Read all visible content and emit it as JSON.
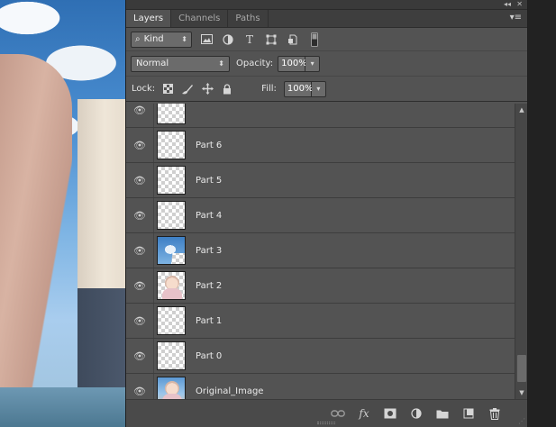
{
  "panel": {
    "collapse_icon": "double-chevron-left-icon",
    "close_icon": "close-x-icon",
    "tabs": [
      {
        "label": "Layers",
        "active": true
      },
      {
        "label": "Channels",
        "active": false
      },
      {
        "label": "Paths",
        "active": false
      }
    ],
    "menu_icon": "panel-menu-icon"
  },
  "filter": {
    "kind_label": "Kind",
    "icons": [
      "pixel-layer-filter-icon",
      "adjustment-filter-icon",
      "type-filter-icon",
      "shape-filter-icon",
      "smart-object-filter-icon",
      "filter-toggle-icon"
    ]
  },
  "blend": {
    "mode": "Normal",
    "opacity_label": "Opacity:",
    "opacity_value": "100%"
  },
  "lock": {
    "label": "Lock:",
    "icons": [
      "lock-transparent-pixels-icon",
      "lock-image-pixels-icon",
      "lock-position-icon",
      "lock-all-icon"
    ],
    "fill_label": "Fill:",
    "fill_value": "100%"
  },
  "layers": [
    {
      "name": "",
      "thumb": "transparent",
      "visible": true
    },
    {
      "name": "Part 6",
      "thumb": "transparent",
      "visible": true
    },
    {
      "name": "Part 5",
      "thumb": "transparent",
      "visible": true
    },
    {
      "name": "Part 4",
      "thumb": "transparent",
      "visible": true
    },
    {
      "name": "Part 3",
      "thumb": "sky",
      "visible": true
    },
    {
      "name": "Part 2",
      "thumb": "girl",
      "visible": true
    },
    {
      "name": "Part 1",
      "thumb": "transparent",
      "visible": true
    },
    {
      "name": "Part 0",
      "thumb": "transparent",
      "visible": true
    },
    {
      "name": "Original_Image",
      "thumb": "photo",
      "visible": true
    }
  ],
  "bottom_toolbar": {
    "icons": [
      "link-layers-icon",
      "fx-layer-style-icon",
      "add-mask-icon",
      "new-adjustment-layer-icon",
      "new-group-folder-icon",
      "new-layer-icon",
      "delete-layer-icon"
    ],
    "fx_label": "fx"
  },
  "colors": {
    "panel_bg": "#535353",
    "tab_bar_bg": "#3e3e3e",
    "field_bg": "#6b6b6b"
  }
}
